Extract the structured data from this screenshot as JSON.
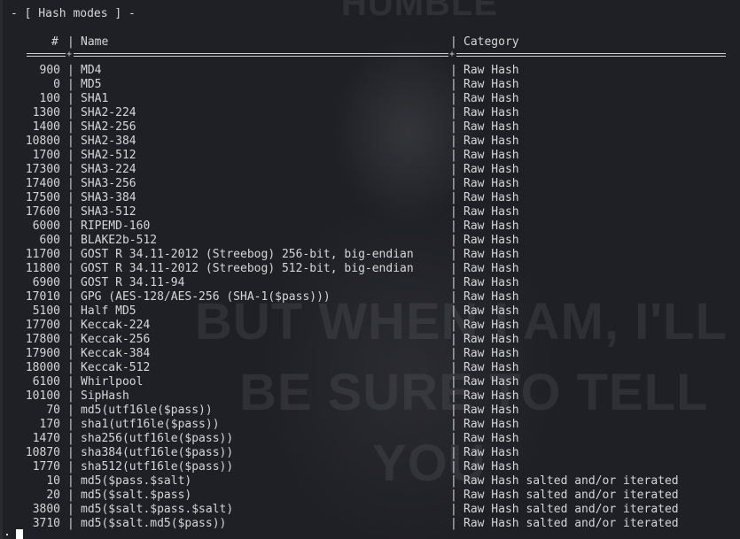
{
  "section_title": "- [ Hash modes ] -",
  "background_text": [
    "HUMBLE",
    "BUT WHEN I AM, I'LL",
    "BE SURE TO TELL",
    "YOU"
  ],
  "columns": {
    "num": "#",
    "name": "Name",
    "category": "Category"
  },
  "rows": [
    {
      "num": "900",
      "name": "MD4",
      "category": "Raw Hash"
    },
    {
      "num": "0",
      "name": "MD5",
      "category": "Raw Hash"
    },
    {
      "num": "100",
      "name": "SHA1",
      "category": "Raw Hash"
    },
    {
      "num": "1300",
      "name": "SHA2-224",
      "category": "Raw Hash"
    },
    {
      "num": "1400",
      "name": "SHA2-256",
      "category": "Raw Hash"
    },
    {
      "num": "10800",
      "name": "SHA2-384",
      "category": "Raw Hash"
    },
    {
      "num": "1700",
      "name": "SHA2-512",
      "category": "Raw Hash"
    },
    {
      "num": "17300",
      "name": "SHA3-224",
      "category": "Raw Hash"
    },
    {
      "num": "17400",
      "name": "SHA3-256",
      "category": "Raw Hash"
    },
    {
      "num": "17500",
      "name": "SHA3-384",
      "category": "Raw Hash"
    },
    {
      "num": "17600",
      "name": "SHA3-512",
      "category": "Raw Hash"
    },
    {
      "num": "6000",
      "name": "RIPEMD-160",
      "category": "Raw Hash"
    },
    {
      "num": "600",
      "name": "BLAKE2b-512",
      "category": "Raw Hash"
    },
    {
      "num": "11700",
      "name": "GOST R 34.11-2012 (Streebog) 256-bit, big-endian",
      "category": "Raw Hash"
    },
    {
      "num": "11800",
      "name": "GOST R 34.11-2012 (Streebog) 512-bit, big-endian",
      "category": "Raw Hash"
    },
    {
      "num": "6900",
      "name": "GOST R 34.11-94",
      "category": "Raw Hash"
    },
    {
      "num": "17010",
      "name": "GPG (AES-128/AES-256 (SHA-1($pass)))",
      "category": "Raw Hash"
    },
    {
      "num": "5100",
      "name": "Half MD5",
      "category": "Raw Hash"
    },
    {
      "num": "17700",
      "name": "Keccak-224",
      "category": "Raw Hash"
    },
    {
      "num": "17800",
      "name": "Keccak-256",
      "category": "Raw Hash"
    },
    {
      "num": "17900",
      "name": "Keccak-384",
      "category": "Raw Hash"
    },
    {
      "num": "18000",
      "name": "Keccak-512",
      "category": "Raw Hash"
    },
    {
      "num": "6100",
      "name": "Whirlpool",
      "category": "Raw Hash"
    },
    {
      "num": "10100",
      "name": "SipHash",
      "category": "Raw Hash"
    },
    {
      "num": "70",
      "name": "md5(utf16le($pass))",
      "category": "Raw Hash"
    },
    {
      "num": "170",
      "name": "sha1(utf16le($pass))",
      "category": "Raw Hash"
    },
    {
      "num": "1470",
      "name": "sha256(utf16le($pass))",
      "category": "Raw Hash"
    },
    {
      "num": "10870",
      "name": "sha384(utf16le($pass))",
      "category": "Raw Hash"
    },
    {
      "num": "1770",
      "name": "sha512(utf16le($pass))",
      "category": "Raw Hash"
    },
    {
      "num": "10",
      "name": "md5($pass.$salt)",
      "category": "Raw Hash salted and/or iterated"
    },
    {
      "num": "20",
      "name": "md5($salt.$pass)",
      "category": "Raw Hash salted and/or iterated"
    },
    {
      "num": "3800",
      "name": "md5($salt.$pass.$salt)",
      "category": "Raw Hash salted and/or iterated"
    },
    {
      "num": "3710",
      "name": "md5($salt.md5($pass))",
      "category": "Raw Hash salted and/or iterated"
    }
  ],
  "colors": {
    "background": "#1f2025",
    "text": "#d6d6d6",
    "cursor": "#ffffff"
  }
}
